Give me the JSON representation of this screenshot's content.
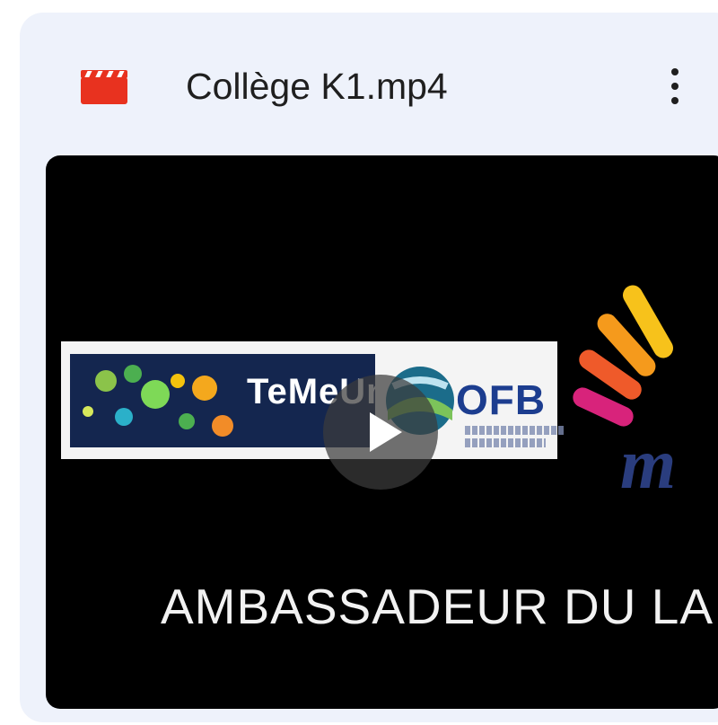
{
  "file": {
    "name": "Collège K1.mp4",
    "type_icon": "video-file-icon",
    "menu_icon": "more-vert-icon"
  },
  "thumbnail": {
    "caption": "AMBASSADEUR DU LA",
    "logo_left_text": "TeMeUm",
    "logo_right_text": "OFB",
    "play_icon": "play-icon"
  },
  "colors": {
    "card_background": "#eef2fb",
    "video_icon": "#e8321f",
    "thumbnail_background": "#000000",
    "ofb_blue": "#1c3d8f"
  }
}
